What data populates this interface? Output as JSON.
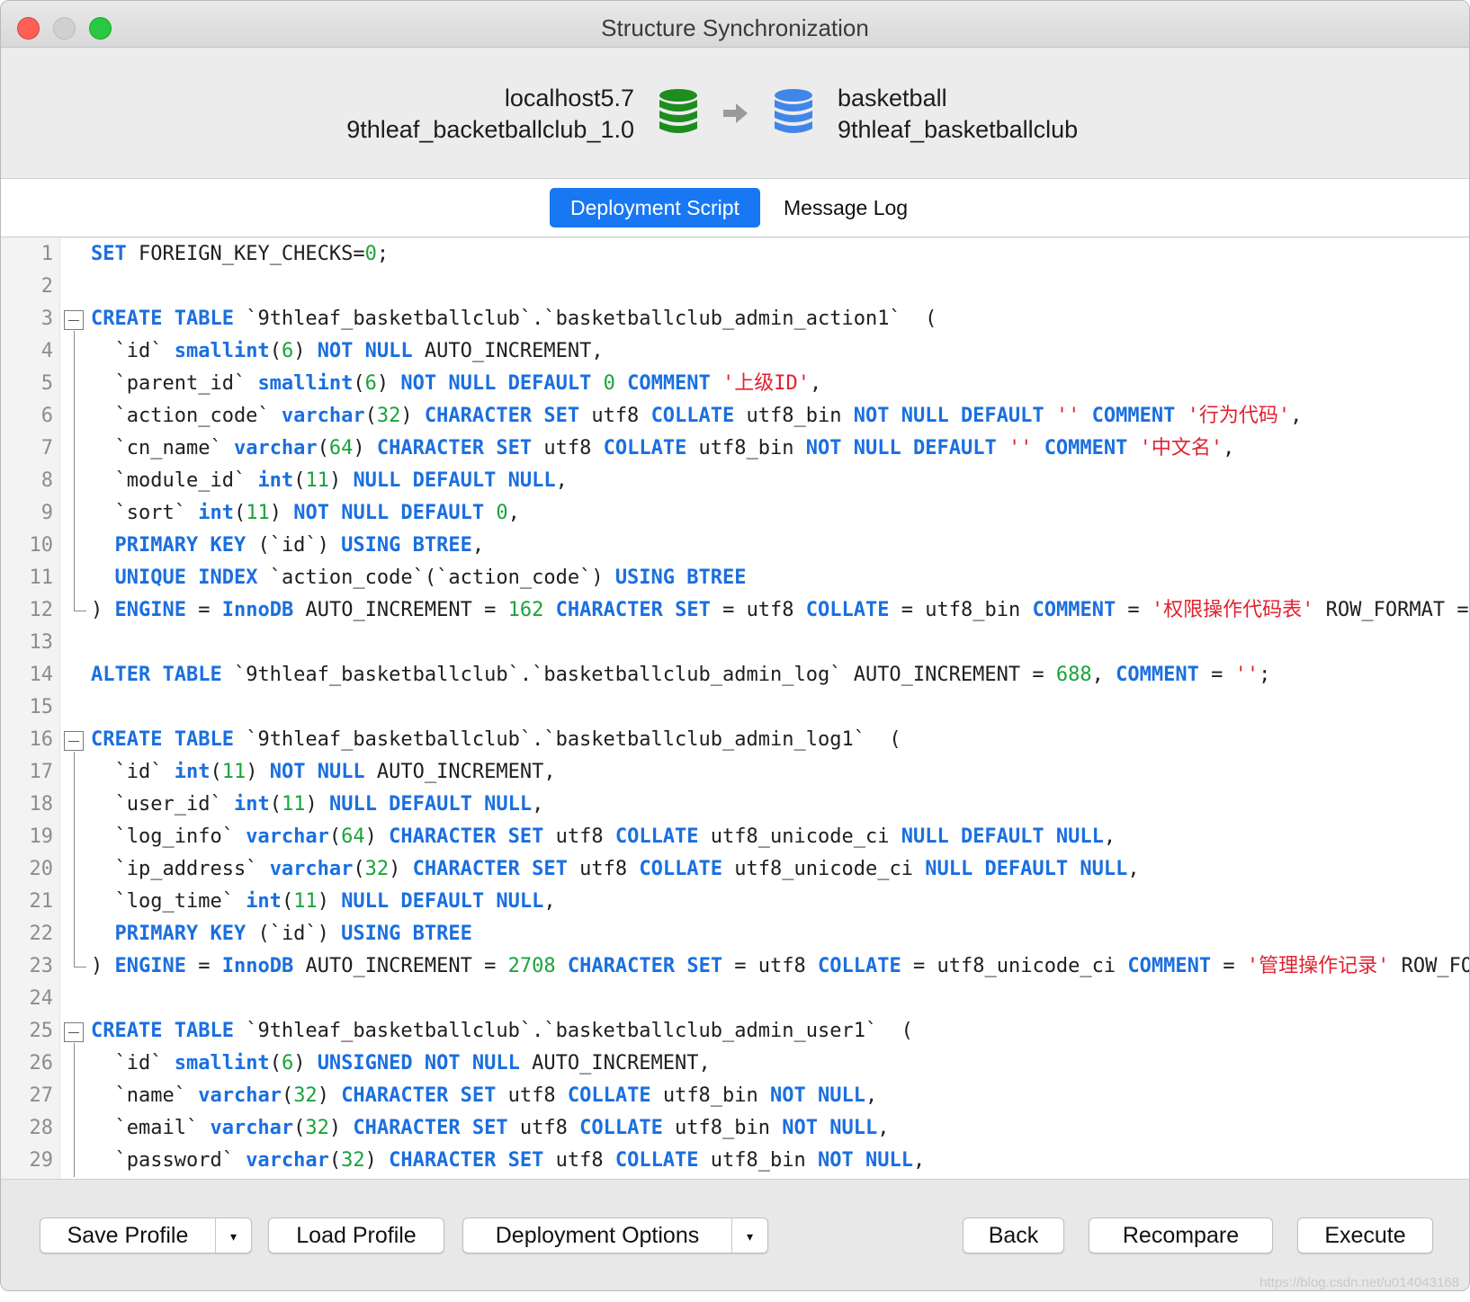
{
  "window": {
    "title": "Structure Synchronization"
  },
  "connection": {
    "source": {
      "server": "localhost5.7",
      "database": "9thleaf_backetballclub_1.0",
      "icon": "database-icon",
      "color": "#1f8c1f"
    },
    "target": {
      "server": "basketball",
      "database": "9thleaf_basketballclub",
      "icon": "database-icon",
      "color": "#3f86e8"
    },
    "arrow_icon": "arrow-right-icon"
  },
  "tabs": [
    {
      "label": "Deployment Script",
      "active": true
    },
    {
      "label": "Message Log",
      "active": false
    }
  ],
  "colors": {
    "keyword": "#1a6fe0",
    "number": "#1aa33a",
    "string": "#e0222f",
    "accent": "#1877f2"
  },
  "editor": {
    "lines": [
      [
        [
          "k",
          "SET"
        ],
        [
          "t",
          " FOREIGN_KEY_CHECKS="
        ],
        [
          "n",
          "0"
        ],
        [
          "t",
          ";"
        ]
      ],
      [],
      [
        [
          "k",
          "CREATE TABLE"
        ],
        [
          "t",
          " `9thleaf_basketballclub`.`basketballclub_admin_action1`  ("
        ]
      ],
      [
        [
          "t",
          "  `id` "
        ],
        [
          "k",
          "smallint"
        ],
        [
          "t",
          "("
        ],
        [
          "n",
          "6"
        ],
        [
          "t",
          ") "
        ],
        [
          "k",
          "NOT NULL"
        ],
        [
          "t",
          " AUTO_INCREMENT,"
        ]
      ],
      [
        [
          "t",
          "  `parent_id` "
        ],
        [
          "k",
          "smallint"
        ],
        [
          "t",
          "("
        ],
        [
          "n",
          "6"
        ],
        [
          "t",
          ") "
        ],
        [
          "k",
          "NOT NULL DEFAULT"
        ],
        [
          "t",
          " "
        ],
        [
          "n",
          "0"
        ],
        [
          "t",
          " "
        ],
        [
          "k",
          "COMMENT"
        ],
        [
          "t",
          " "
        ],
        [
          "s",
          "'上级ID'"
        ],
        [
          "t",
          ","
        ]
      ],
      [
        [
          "t",
          "  `action_code` "
        ],
        [
          "k",
          "varchar"
        ],
        [
          "t",
          "("
        ],
        [
          "n",
          "32"
        ],
        [
          "t",
          ") "
        ],
        [
          "k",
          "CHARACTER SET"
        ],
        [
          "t",
          " utf8 "
        ],
        [
          "k",
          "COLLATE"
        ],
        [
          "t",
          " utf8_bin "
        ],
        [
          "k",
          "NOT NULL DEFAULT"
        ],
        [
          "t",
          " "
        ],
        [
          "s",
          "''"
        ],
        [
          "t",
          " "
        ],
        [
          "k",
          "COMMENT"
        ],
        [
          "t",
          " "
        ],
        [
          "s",
          "'行为代码'"
        ],
        [
          "t",
          ","
        ]
      ],
      [
        [
          "t",
          "  `cn_name` "
        ],
        [
          "k",
          "varchar"
        ],
        [
          "t",
          "("
        ],
        [
          "n",
          "64"
        ],
        [
          "t",
          ") "
        ],
        [
          "k",
          "CHARACTER SET"
        ],
        [
          "t",
          " utf8 "
        ],
        [
          "k",
          "COLLATE"
        ],
        [
          "t",
          " utf8_bin "
        ],
        [
          "k",
          "NOT NULL DEFAULT"
        ],
        [
          "t",
          " "
        ],
        [
          "s",
          "''"
        ],
        [
          "t",
          " "
        ],
        [
          "k",
          "COMMENT"
        ],
        [
          "t",
          " "
        ],
        [
          "s",
          "'中文名'"
        ],
        [
          "t",
          ","
        ]
      ],
      [
        [
          "t",
          "  `module_id` "
        ],
        [
          "k",
          "int"
        ],
        [
          "t",
          "("
        ],
        [
          "n",
          "11"
        ],
        [
          "t",
          ") "
        ],
        [
          "k",
          "NULL DEFAULT NULL"
        ],
        [
          "t",
          ","
        ]
      ],
      [
        [
          "t",
          "  `sort` "
        ],
        [
          "k",
          "int"
        ],
        [
          "t",
          "("
        ],
        [
          "n",
          "11"
        ],
        [
          "t",
          ") "
        ],
        [
          "k",
          "NOT NULL DEFAULT"
        ],
        [
          "t",
          " "
        ],
        [
          "n",
          "0"
        ],
        [
          "t",
          ","
        ]
      ],
      [
        [
          "t",
          "  "
        ],
        [
          "k",
          "PRIMARY KEY"
        ],
        [
          "t",
          " (`id`) "
        ],
        [
          "k",
          "USING BTREE"
        ],
        [
          "t",
          ","
        ]
      ],
      [
        [
          "t",
          "  "
        ],
        [
          "k",
          "UNIQUE INDEX"
        ],
        [
          "t",
          " `action_code`(`action_code`) "
        ],
        [
          "k",
          "USING BTREE"
        ]
      ],
      [
        [
          "t",
          ") "
        ],
        [
          "k",
          "ENGINE"
        ],
        [
          "t",
          " = "
        ],
        [
          "k",
          "InnoDB"
        ],
        [
          "t",
          " AUTO_INCREMENT = "
        ],
        [
          "n",
          "162"
        ],
        [
          "t",
          " "
        ],
        [
          "k",
          "CHARACTER SET"
        ],
        [
          "t",
          " = utf8 "
        ],
        [
          "k",
          "COLLATE"
        ],
        [
          "t",
          " = utf8_bin "
        ],
        [
          "k",
          "COMMENT"
        ],
        [
          "t",
          " = "
        ],
        [
          "s",
          "'权限操作代码表'"
        ],
        [
          "t",
          " ROW_FORMAT = "
        ]
      ],
      [],
      [
        [
          "k",
          "ALTER TABLE"
        ],
        [
          "t",
          " `9thleaf_basketballclub`.`basketballclub_admin_log` AUTO_INCREMENT = "
        ],
        [
          "n",
          "688"
        ],
        [
          "t",
          ", "
        ],
        [
          "k",
          "COMMENT"
        ],
        [
          "t",
          " = "
        ],
        [
          "s",
          "''"
        ],
        [
          "t",
          ";"
        ]
      ],
      [],
      [
        [
          "k",
          "CREATE TABLE"
        ],
        [
          "t",
          " `9thleaf_basketballclub`.`basketballclub_admin_log1`  ("
        ]
      ],
      [
        [
          "t",
          "  `id` "
        ],
        [
          "k",
          "int"
        ],
        [
          "t",
          "("
        ],
        [
          "n",
          "11"
        ],
        [
          "t",
          ") "
        ],
        [
          "k",
          "NOT NULL"
        ],
        [
          "t",
          " AUTO_INCREMENT,"
        ]
      ],
      [
        [
          "t",
          "  `user_id` "
        ],
        [
          "k",
          "int"
        ],
        [
          "t",
          "("
        ],
        [
          "n",
          "11"
        ],
        [
          "t",
          ") "
        ],
        [
          "k",
          "NULL DEFAULT NULL"
        ],
        [
          "t",
          ","
        ]
      ],
      [
        [
          "t",
          "  `log_info` "
        ],
        [
          "k",
          "varchar"
        ],
        [
          "t",
          "("
        ],
        [
          "n",
          "64"
        ],
        [
          "t",
          ") "
        ],
        [
          "k",
          "CHARACTER SET"
        ],
        [
          "t",
          " utf8 "
        ],
        [
          "k",
          "COLLATE"
        ],
        [
          "t",
          " utf8_unicode_ci "
        ],
        [
          "k",
          "NULL DEFAULT NULL"
        ],
        [
          "t",
          ","
        ]
      ],
      [
        [
          "t",
          "  `ip_address` "
        ],
        [
          "k",
          "varchar"
        ],
        [
          "t",
          "("
        ],
        [
          "n",
          "32"
        ],
        [
          "t",
          ") "
        ],
        [
          "k",
          "CHARACTER SET"
        ],
        [
          "t",
          " utf8 "
        ],
        [
          "k",
          "COLLATE"
        ],
        [
          "t",
          " utf8_unicode_ci "
        ],
        [
          "k",
          "NULL DEFAULT NULL"
        ],
        [
          "t",
          ","
        ]
      ],
      [
        [
          "t",
          "  `log_time` "
        ],
        [
          "k",
          "int"
        ],
        [
          "t",
          "("
        ],
        [
          "n",
          "11"
        ],
        [
          "t",
          ") "
        ],
        [
          "k",
          "NULL DEFAULT NULL"
        ],
        [
          "t",
          ","
        ]
      ],
      [
        [
          "t",
          "  "
        ],
        [
          "k",
          "PRIMARY KEY"
        ],
        [
          "t",
          " (`id`) "
        ],
        [
          "k",
          "USING BTREE"
        ]
      ],
      [
        [
          "t",
          ") "
        ],
        [
          "k",
          "ENGINE"
        ],
        [
          "t",
          " = "
        ],
        [
          "k",
          "InnoDB"
        ],
        [
          "t",
          " AUTO_INCREMENT = "
        ],
        [
          "n",
          "2708"
        ],
        [
          "t",
          " "
        ],
        [
          "k",
          "CHARACTER SET"
        ],
        [
          "t",
          " = utf8 "
        ],
        [
          "k",
          "COLLATE"
        ],
        [
          "t",
          " = utf8_unicode_ci "
        ],
        [
          "k",
          "COMMENT"
        ],
        [
          "t",
          " = "
        ],
        [
          "s",
          "'管理操作记录'"
        ],
        [
          "t",
          " ROW_FO"
        ]
      ],
      [],
      [
        [
          "k",
          "CREATE TABLE"
        ],
        [
          "t",
          " `9thleaf_basketballclub`.`basketballclub_admin_user1`  ("
        ]
      ],
      [
        [
          "t",
          "  `id` "
        ],
        [
          "k",
          "smallint"
        ],
        [
          "t",
          "("
        ],
        [
          "n",
          "6"
        ],
        [
          "t",
          ") "
        ],
        [
          "k",
          "UNSIGNED NOT NULL"
        ],
        [
          "t",
          " AUTO_INCREMENT,"
        ]
      ],
      [
        [
          "t",
          "  `name` "
        ],
        [
          "k",
          "varchar"
        ],
        [
          "t",
          "("
        ],
        [
          "n",
          "32"
        ],
        [
          "t",
          ") "
        ],
        [
          "k",
          "CHARACTER SET"
        ],
        [
          "t",
          " utf8 "
        ],
        [
          "k",
          "COLLATE"
        ],
        [
          "t",
          " utf8_bin "
        ],
        [
          "k",
          "NOT NULL"
        ],
        [
          "t",
          ","
        ]
      ],
      [
        [
          "t",
          "  `email` "
        ],
        [
          "k",
          "varchar"
        ],
        [
          "t",
          "("
        ],
        [
          "n",
          "32"
        ],
        [
          "t",
          ") "
        ],
        [
          "k",
          "CHARACTER SET"
        ],
        [
          "t",
          " utf8 "
        ],
        [
          "k",
          "COLLATE"
        ],
        [
          "t",
          " utf8_bin "
        ],
        [
          "k",
          "NOT NULL"
        ],
        [
          "t",
          ","
        ]
      ],
      [
        [
          "t",
          "  `password` "
        ],
        [
          "k",
          "varchar"
        ],
        [
          "t",
          "("
        ],
        [
          "n",
          "32"
        ],
        [
          "t",
          ") "
        ],
        [
          "k",
          "CHARACTER SET"
        ],
        [
          "t",
          " utf8 "
        ],
        [
          "k",
          "COLLATE"
        ],
        [
          "t",
          " utf8_bin "
        ],
        [
          "k",
          "NOT NULL"
        ],
        [
          "t",
          ","
        ]
      ]
    ],
    "fold_starts": [
      3,
      16,
      25
    ],
    "fold_ends": [
      12,
      23
    ]
  },
  "buttons": {
    "save_profile": "Save Profile",
    "load_profile": "Load Profile",
    "deployment_options": "Deployment Options",
    "back": "Back",
    "recompare": "Recompare",
    "execute": "Execute",
    "dropdown_glyph": "▾"
  },
  "watermark": "https://blog.csdn.net/u014043168"
}
